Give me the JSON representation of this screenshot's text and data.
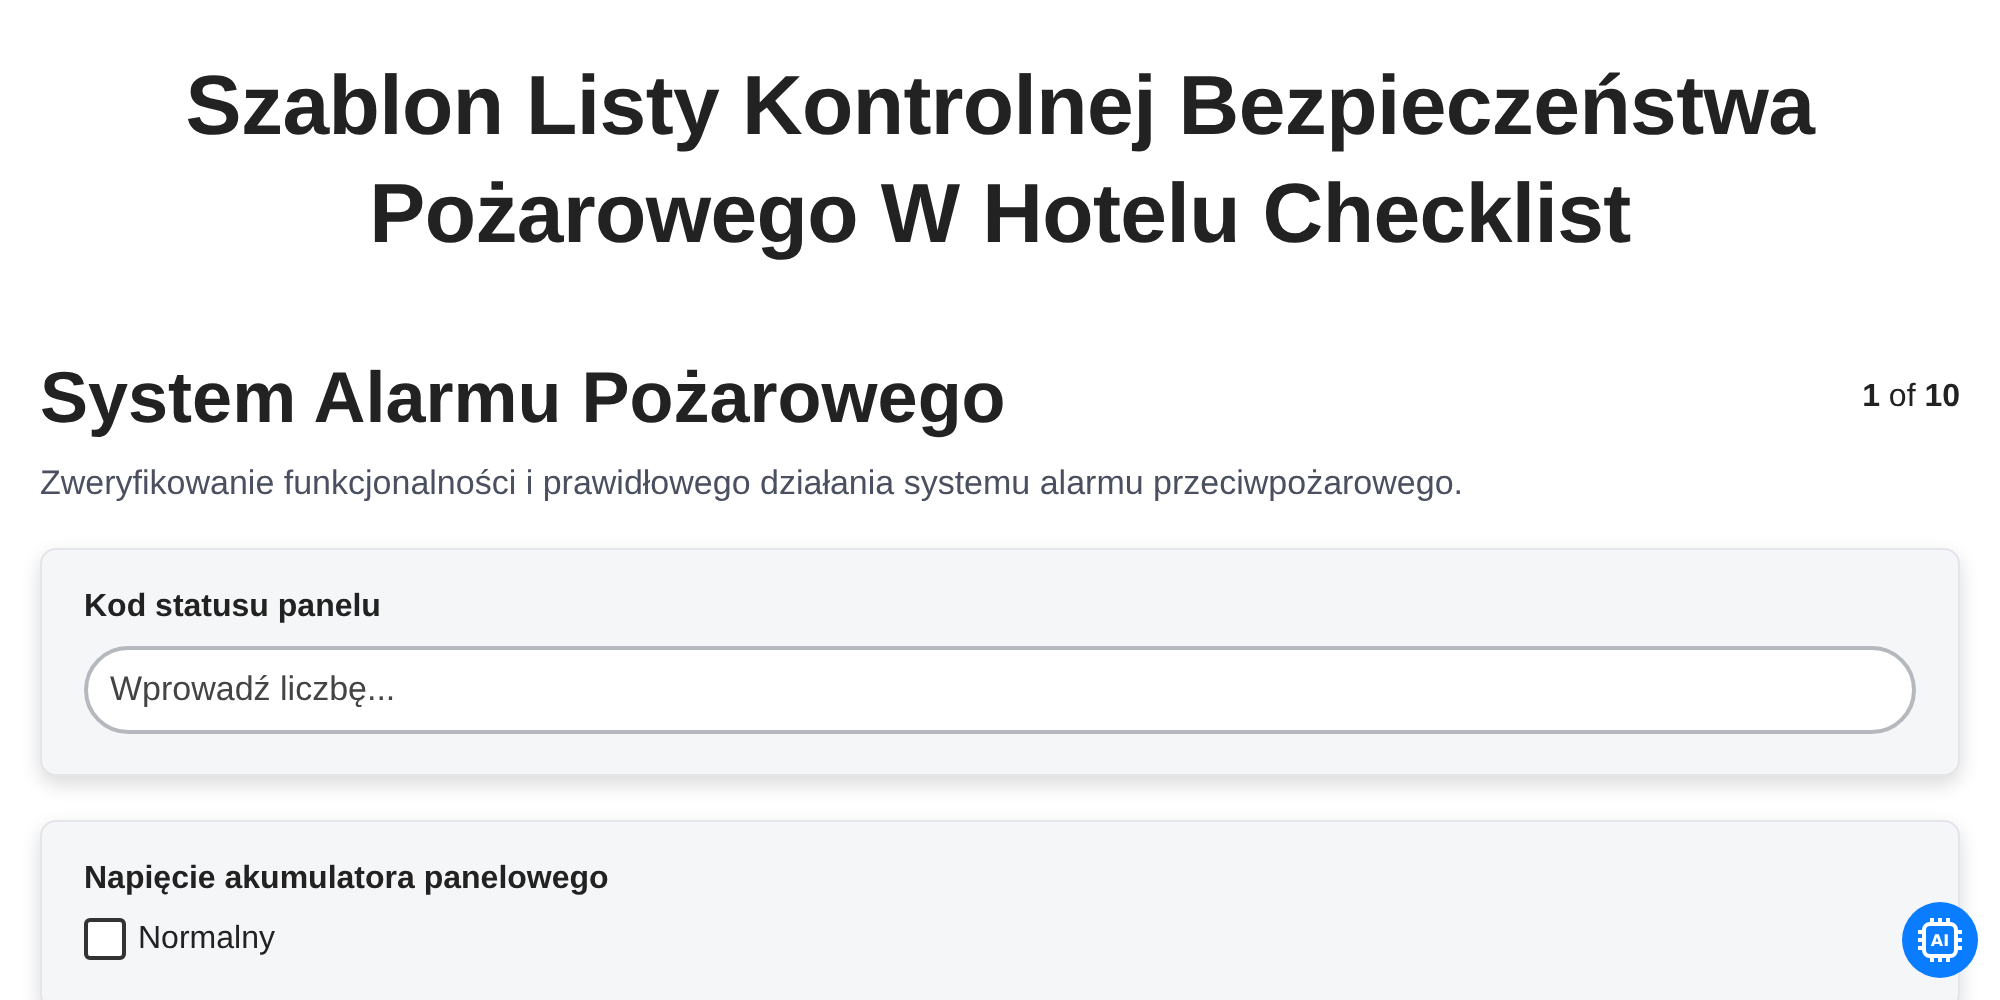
{
  "title": "Szablon Listy Kontrolnej Bezpieczeństwa Pożarowego W Hotelu Checklist",
  "section": {
    "heading": "System Alarmu Pożarowego",
    "pager": "**1** of **10**",
    "description": "Zweryfikowanie funkcjonalności i prawidłowego działania systemu alarmu przeciwpożarowego."
  },
  "questions": [
    {
      "kind": "number",
      "label": "Kod statusu panelu",
      "placeholder": "Wprowadź liczbę..."
    },
    {
      "kind": "checklist",
      "label": "Napięcie akumulatora panelowego",
      "options": [
        {
          "label": "Normalny",
          "checked": false
        }
      ]
    }
  ],
  "assistant_button": {
    "label": "AI"
  }
}
